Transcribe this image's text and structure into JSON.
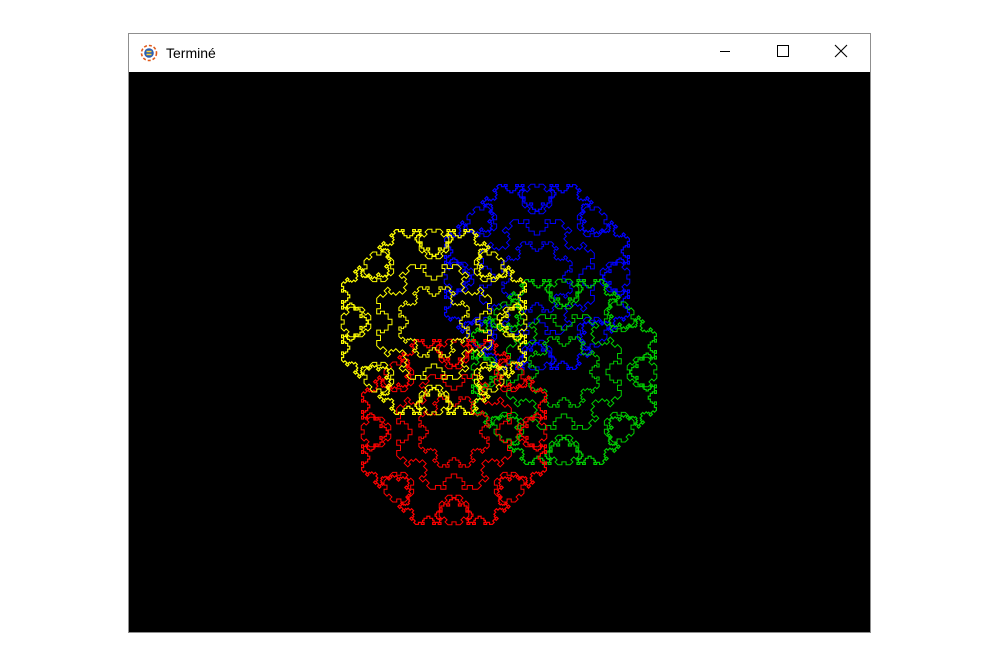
{
  "window": {
    "title": "Terminé",
    "app_icon": "python-turtle-icon",
    "controls": {
      "minimize_icon": "minimize-icon",
      "maximize_icon": "maximize-icon",
      "close_icon": "close-icon"
    }
  },
  "canvas": {
    "background": "#000000",
    "fractal": "octagonal-recursive-curve",
    "depth": 4,
    "colors": {
      "blue": "#0000ff",
      "green": "#00cc00",
      "red": "#ff0000",
      "yellow": "#ffff00"
    },
    "shapes": [
      {
        "name": "blue-fractal",
        "color_key": "blue"
      },
      {
        "name": "green-fractal",
        "color_key": "green"
      },
      {
        "name": "red-fractal",
        "color_key": "red"
      },
      {
        "name": "yellow-fractal",
        "color_key": "yellow"
      }
    ]
  }
}
